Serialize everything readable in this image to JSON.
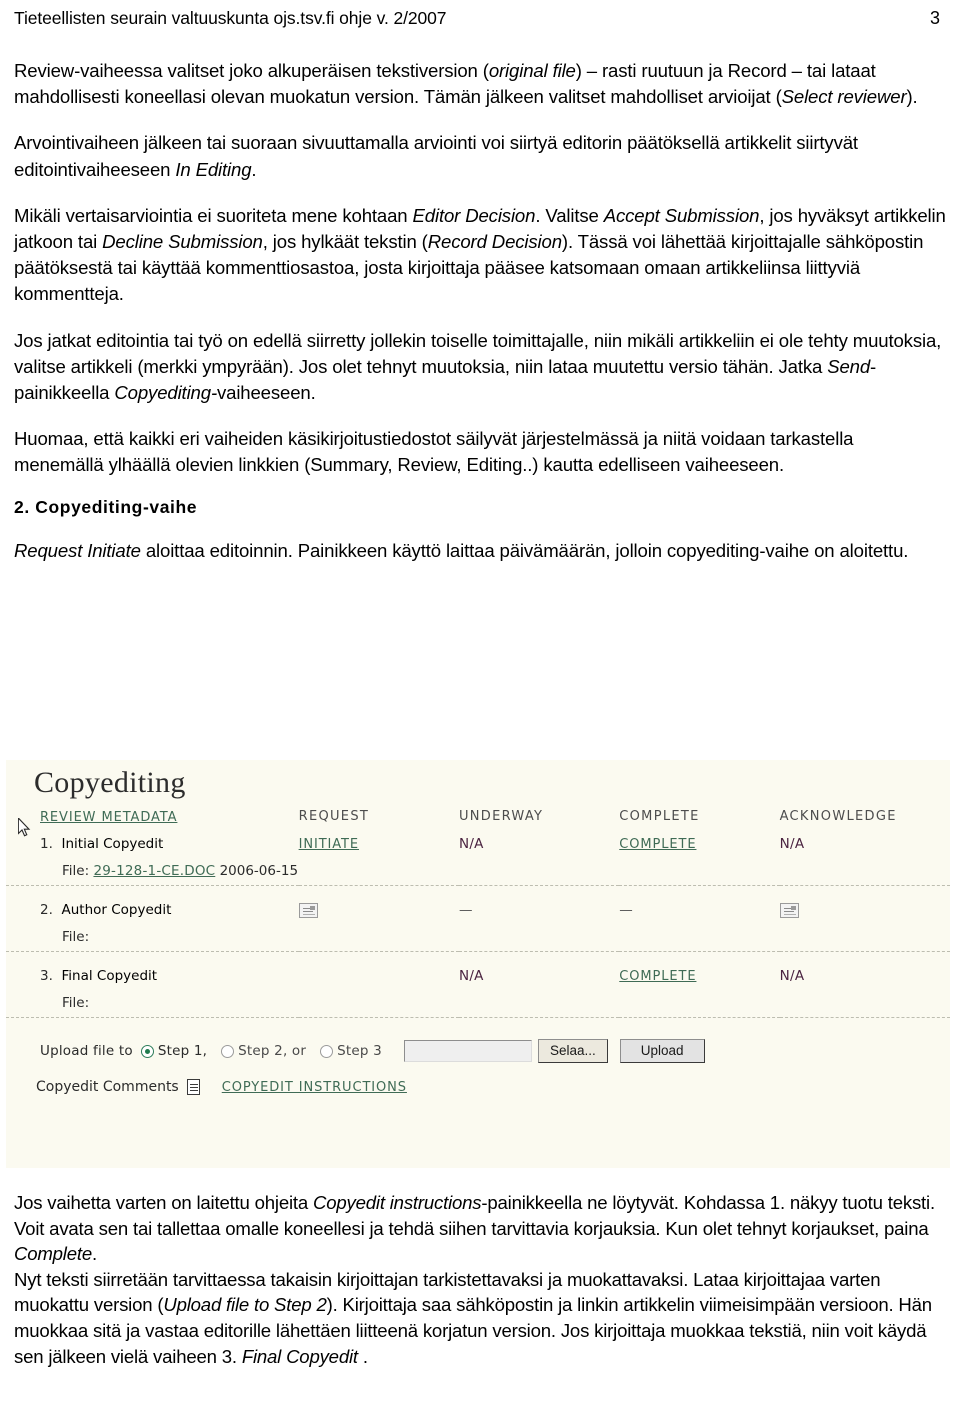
{
  "header": {
    "title": "Tieteellisten seurain valtuuskunta ojs.tsv.fi ohje v. 2/2007",
    "page_number": "3"
  },
  "paragraphs": {
    "p1_a": "Review-vaiheessa valitset joko alkuperäisen tekstiversion (",
    "p1_i1": "original file",
    "p1_b": ") – rasti ruutuun ja Record – tai lataat mahdollisesti koneellasi olevan muokatun version. Tämän jälkeen valitset mahdolliset arvioijat (",
    "p1_i2": "Select reviewer",
    "p1_c": ").",
    "p2_a": "Arvointivaiheen jälkeen tai suoraan sivuuttamalla arviointi voi siirtyä  editorin päätöksellä artikkelit siirtyvät editointivaiheeseen ",
    "p2_i1": "In Editing",
    "p2_b": ".",
    "p3_a": "Mikäli vertaisarviointia ei suoriteta mene kohtaan ",
    "p3_i1": "Editor Decision",
    "p3_b": ". Valitse ",
    "p3_i2": "Accept Submission",
    "p3_c": ", jos hyväksyt artikkelin jatkoon tai ",
    "p3_i3": "Decline Submission",
    "p3_d": ", jos hylkäät tekstin (",
    "p3_i4": "Record Decision",
    "p3_e": "). Tässä voi lähettää kirjoittajalle sähköpostin päätöksestä tai käyttää kommenttiosastoa, josta kirjoittaja pääsee katsomaan omaan artikkeliinsa liittyviä kommentteja.",
    "p4_a": "Jos jatkat editointia tai työ on edellä siirretty jollekin toiselle toimittajalle, niin mikäli artikkeliin ei ole tehty muutoksia, valitse artikkeli (merkki ympyrään). Jos olet tehnyt muutoksia, niin lataa muutettu versio tähän. Jatka ",
    "p4_i1": "Send",
    "p4_b": "-painikkeella ",
    "p4_i2": "Copyediting-",
    "p4_c": "vaiheeseen.",
    "p5": "Huomaa, että kaikki eri vaiheiden käsikirjoitustiedostot säilyvät järjestelmässä ja niitä voidaan tarkastella menemällä ylhäällä olevien linkkien (Summary, Review, Editing..) kautta edelliseen vaiheeseen.",
    "section_heading": "2. Copyediting-vaihe",
    "p6_i1": "Request Initiate",
    "p6_a": " aloittaa editoinnin. Painikkeen käyttö laittaa päivämäärän, jolloin copyediting-vaihe on aloitettu."
  },
  "screenshot": {
    "title": "Copyediting",
    "review_metadata_link": "REVIEW METADATA",
    "columns": [
      "REQUEST",
      "UNDERWAY",
      "COMPLETE",
      "ACKNOWLEDGE"
    ],
    "rows": [
      {
        "num": "1.",
        "label": "Initial Copyedit",
        "request": "INITIATE",
        "request_is_link": true,
        "underway": "N/A",
        "underway_is_link": false,
        "complete": "COMPLETE",
        "complete_is_link": true,
        "acknowledge": "N/A",
        "acknowledge_is_link": false,
        "file_label": "File:",
        "file_name": "29-128-1-CE.DOC",
        "file_date": "2006-06-15"
      },
      {
        "num": "2.",
        "label": "Author Copyedit",
        "request": "mail-icon",
        "request_is_link": false,
        "underway": "—",
        "underway_is_link": false,
        "complete": "—",
        "complete_is_link": false,
        "acknowledge": "mail-icon",
        "acknowledge_is_link": false,
        "file_label": "File:",
        "file_name": "",
        "file_date": ""
      },
      {
        "num": "3.",
        "label": "Final Copyedit",
        "request": "",
        "request_is_link": false,
        "underway": "N/A",
        "underway_is_link": false,
        "complete": "COMPLETE",
        "complete_is_link": true,
        "acknowledge": "N/A",
        "acknowledge_is_link": false,
        "file_label": "File:",
        "file_name": "",
        "file_date": ""
      }
    ],
    "upload": {
      "label": "Upload file to",
      "step1": "Step 1,",
      "step2": "Step 2, or",
      "step3": "Step 3",
      "step1_selected": true,
      "file_value": "",
      "browse_button": "Selaa...",
      "upload_button": "Upload"
    },
    "comments": {
      "label": "Copyedit Comments",
      "instructions_link": "COPYEDIT INSTRUCTIONS"
    },
    "colors": {
      "background": "#fbfaf0",
      "link": "#3f6b55",
      "na": "#4a2340",
      "radio_selected": "#1f7a4d"
    }
  },
  "tail": {
    "t1_a": "Jos vaihetta varten on laitettu ohjeita ",
    "t1_i1": "Copyedit instructions",
    "t1_b": "-painikkeella ne löytyvät. Kohdassa 1. näkyy tuotu teksti. Voit avata sen tai tallettaa omalle koneellesi ja tehdä siihen tarvittavia korjauksia. Kun olet tehnyt korjaukset, paina ",
    "t1_i2": "Complete",
    "t1_c": ".",
    "t2_a": "Nyt teksti siirretään tarvittaessa takaisin kirjoittajan tarkistettavaksi ja muokattavaksi. Lataa kirjoittajaa varten muokattu version (",
    "t2_i1": "Upload file to Step 2",
    "t2_b": "). Kirjoittaja saa sähköpostin ja linkin artikkelin viimeisimpään versioon. Hän muokkaa sitä ja vastaa editorille lähettäen liitteenä korjatun version. Jos kirjoittaja muokkaa tekstiä, niin voit käydä sen jälkeen vielä vaiheen 3. ",
    "t2_i2": "Final Copyedit",
    "t2_c": " ."
  }
}
